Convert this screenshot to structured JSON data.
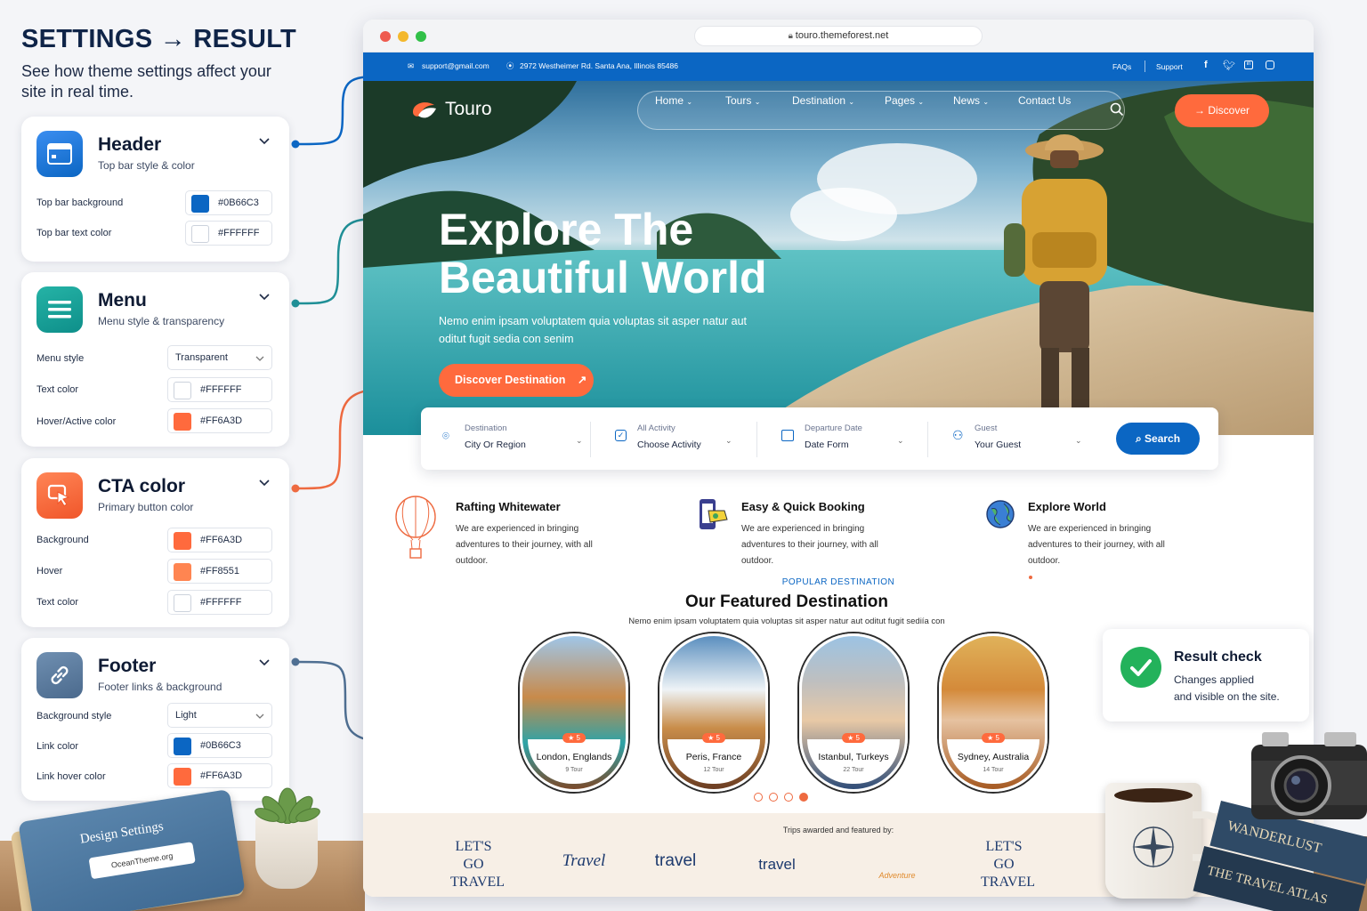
{
  "intro": {
    "title": "SETTINGS → RESULT",
    "subtitle": "See how theme settings affect your site in real time."
  },
  "panels": {
    "header": {
      "title": "Header",
      "subtitle": "Top bar style & color",
      "rows": [
        {
          "label": "Top bar background",
          "value": "#0B66C3",
          "color": "#0B66C3"
        },
        {
          "label": "Top bar text color",
          "value": "#FFFFFF",
          "color": "#FFFFFF"
        }
      ]
    },
    "menu": {
      "title": "Menu",
      "subtitle": "Menu style & transparency",
      "style_label": "Menu style",
      "style_value": "Transparent",
      "rows": [
        {
          "label": "Text color",
          "value": "#FFFFFF",
          "color": "#FFFFFF"
        },
        {
          "label": "Hover/Active color",
          "value": "#FF6A3D",
          "color": "#FF6A3D"
        }
      ]
    },
    "cta": {
      "title": "CTA color",
      "subtitle": "Primary button color",
      "rows": [
        {
          "label": "Background",
          "value": "#FF6A3D",
          "color": "#FF6A3D"
        },
        {
          "label": "Hover",
          "value": "#FF8551",
          "color": "#FF8551"
        },
        {
          "label": "Text color",
          "value": "#FFFFFF",
          "color": "#FFFFFF"
        }
      ]
    },
    "footer": {
      "title": "Footer",
      "subtitle": "Footer links & background",
      "style_label": "Background style",
      "style_value": "Light",
      "rows": [
        {
          "label": "Link color",
          "value": "#0B66C3",
          "color": "#0B66C3"
        },
        {
          "label": "Link hover color",
          "value": "#FF6A3D",
          "color": "#FF6A3D"
        }
      ]
    }
  },
  "folder": {
    "label": "Design Settings",
    "tag": "OceanTheme.org"
  },
  "browser": {
    "url": "touro.themeforest.net",
    "topbar": {
      "email": "support@gmail.com",
      "address": "2972 Westheimer Rd. Santa Ana, Illinois 85486",
      "faqs": "FAQs",
      "support": "Support"
    },
    "brand": "Touro",
    "nav": [
      "Home",
      "Tours",
      "Destination",
      "Pages",
      "News",
      "Contact Us"
    ],
    "nav_cta": "Discover",
    "hero": {
      "title_line1": "Explore The",
      "title_line2": "Beautiful World",
      "text_line1": "Nemo enim ipsam voluptatem quia voluptas sit asper natur aut",
      "text_line2": "oditut fugit sedia con senim",
      "cta": "Discover Destination"
    },
    "search": {
      "fields": [
        {
          "label": "Destination",
          "value": "City Or Region",
          "icon": "pin-icon"
        },
        {
          "label": "All Activity",
          "value": "Choose Activity",
          "icon": "checkbox-icon"
        },
        {
          "label": "Departure Date",
          "value": "Date Form",
          "icon": "calendar-icon"
        },
        {
          "label": "Guest",
          "value": "Your Guest",
          "icon": "user-icon"
        }
      ],
      "button": "Search"
    },
    "features": [
      {
        "title": "Rafting Whitewater",
        "desc": "We are experienced in bringing adventures to their journey, with all outdoor."
      },
      {
        "title": "Easy & Quick Booking",
        "desc": "We are experienced in bringing adventures to their journey, with all outdoor."
      },
      {
        "title": "Explore World",
        "desc": "We are experienced in bringing adventures to their journey, with all outdoor."
      }
    ],
    "popular": {
      "eyebrow": "POPULAR DESTINATION",
      "title": "Our Featured Destination",
      "text": "Nemo enim ipsam voluptatem quia voluptas sit asper natur aut oditut fugit sediía con"
    },
    "destinations": [
      {
        "name": "London, Englands",
        "tours": "9 Tour",
        "rating": "★ 5"
      },
      {
        "name": "Peris, France",
        "tours": "12 Tour",
        "rating": "★ 5"
      },
      {
        "name": "Istanbul, Turkeys",
        "tours": "22 Tour",
        "rating": "★ 5"
      },
      {
        "name": "Sydney, Australia",
        "tours": "14 Tour",
        "rating": "★ 5"
      }
    ],
    "partners_caption": "Trips awarded and featured by:",
    "partners": [
      "LET'S GO TRAVEL",
      "Travel",
      "travel",
      "travel",
      "Adventure",
      "LET'S GO TRAVEL"
    ]
  },
  "result": {
    "title": "Result check",
    "text_line1": "Changes applied",
    "text_line2": "and visible on the site."
  },
  "props": {
    "mug_label": "",
    "book1": "WANDERLUST",
    "book2": "THE TRAVEL ATLAS"
  }
}
